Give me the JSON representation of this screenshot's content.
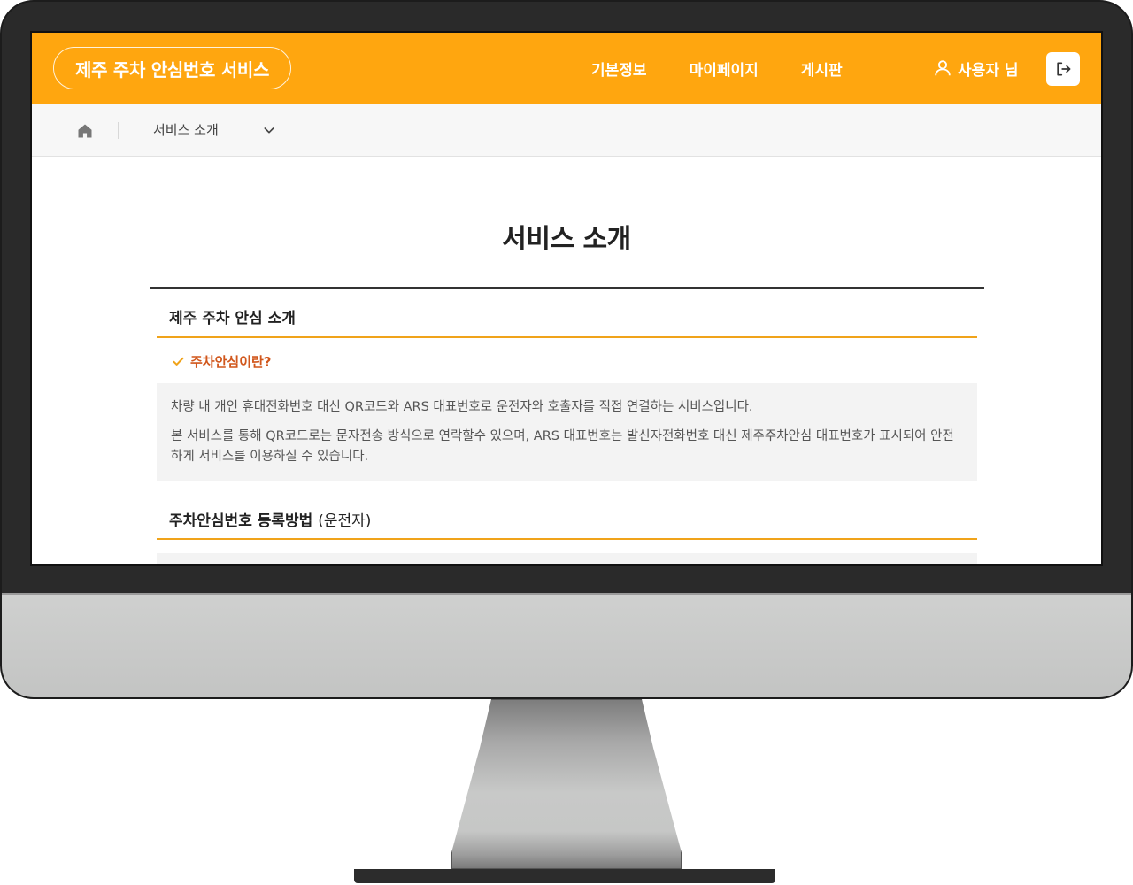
{
  "header": {
    "brand": "제주 주차 안심번호 서비스",
    "nav": [
      "기본정보",
      "마이페이지",
      "게시판"
    ],
    "user_label": "사용자 님",
    "logout_icon": "logout-icon",
    "user_icon": "user-icon"
  },
  "breadcrumb": {
    "home_icon": "home-icon",
    "current": "서비스 소개",
    "dropdown_icon": "chevron-down-icon"
  },
  "main": {
    "title": "서비스 소개",
    "sections": [
      {
        "heading": "제주 주차 안심 소개",
        "subheading": "주차안심이란?",
        "paragraphs": [
          "차량 내 개인 휴대전화번호 대신 QR코드와 ARS 대표번호로 운전자와 호출자를 직접 연결하는 서비스입니다.",
          "본 서비스를 통해 QR코드로는 문자전송 방식으로 연락할수 있으며, ARS 대표번호는 발신자전화번호 대신 제주주차안심 대표번호가 표시되어 안전하게 서비스를 이용하실 수 있습니다."
        ]
      },
      {
        "heading": "주차안심번호 등록방법",
        "heading_suffix": "(운전자)"
      }
    ]
  },
  "colors": {
    "header_bg": "#ffa60f",
    "accent_orange": "#d1571c",
    "rule_orange": "#f0a31a",
    "monitor_bezel": "#2a2a2a",
    "monitor_chin": "#c6c7c6"
  }
}
